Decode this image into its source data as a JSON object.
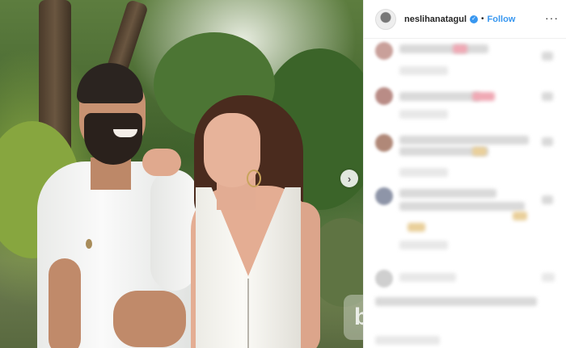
{
  "post": {
    "username": "neslihanatagul",
    "verified_icon": "verified-badge-icon",
    "separator": "•",
    "follow_label": "Follow",
    "more_icon": "more-options-icon",
    "next_icon": "chevron-right-icon",
    "next_glyph": "›",
    "more_glyph": "···",
    "verified_glyph": "✓"
  },
  "watermark": {
    "glyph": "b"
  },
  "colors": {
    "accent": "#3897f0",
    "text": "#262626",
    "border": "#efefef"
  }
}
